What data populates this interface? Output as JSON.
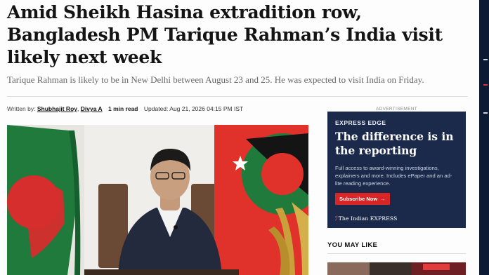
{
  "article": {
    "headline": "Amid Sheikh Hasina extradition row, Bangladesh PM Tarique Rahman’s India visit likely next week",
    "standfirst": "Tarique Rahman is likely to be in New Delhi between August 23 and 25. He was expected to visit India on Friday.",
    "byline": {
      "label": "Written by:",
      "authors": [
        "Shubhajit Roy",
        "Divya A"
      ],
      "separator": ",",
      "read_time": "1 min read",
      "updated": "Updated: Aug 21, 2026 04:15 PM IST"
    }
  },
  "ad": {
    "label": "ADVERTISEMENT",
    "brand": "EXPRESS EDGE",
    "heading": "The difference is in the reporting",
    "copy": "Full access to award-winning investigations, explainers and more. Includes ePaper and an ad-lite reading experience.",
    "cta": "Subscribe Now",
    "cta_arrow": "→",
    "logo_mark": "ℐ",
    "logo_text": "The Indian EXPRESS",
    "colors": {
      "background": "#1b2a4b",
      "cta": "#d92525"
    }
  },
  "sidebar": {
    "you_may_like": "YOU MAY LIKE"
  },
  "colors": {
    "bangladesh_green": "#1f7a3c",
    "bangladesh_red": "#d62d2d",
    "party_flag_red": "#e0322b"
  }
}
